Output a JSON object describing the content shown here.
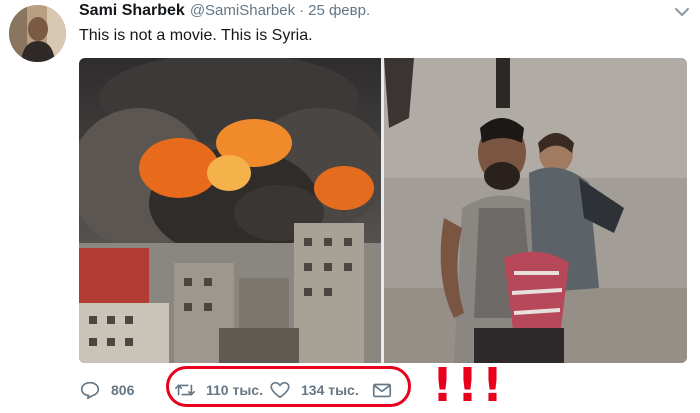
{
  "tweet": {
    "display_name": "Sami Sharbek",
    "handle": "@SamiSharbek",
    "separator": "·",
    "date": "25 февр.",
    "text": "This is not a movie. This is Syria."
  },
  "actions": {
    "reply_count": "806",
    "retweet_count": "110 тыс.",
    "like_count": "134 тыс."
  },
  "annotation": {
    "exclaim": "!!!",
    "color": "#e8001c"
  },
  "icons": [
    "avatar",
    "caret-down-icon",
    "reply-icon",
    "retweet-icon",
    "like-icon",
    "message-icon"
  ]
}
